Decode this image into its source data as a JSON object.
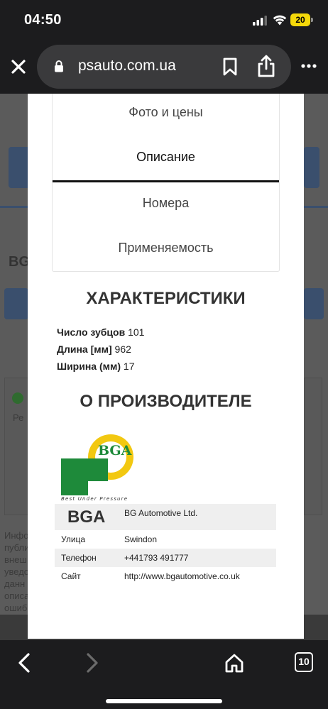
{
  "status": {
    "time": "04:50",
    "battery": "20",
    "icons": [
      "signal-icon",
      "wifi-icon",
      "battery-icon"
    ],
    "battery_color": "#f5d90a"
  },
  "browser": {
    "url": "psauto.com.ua",
    "icons": [
      "close-icon",
      "lock-icon",
      "bookmark-icon",
      "share-icon",
      "more-icon",
      "back-icon",
      "forward-icon",
      "home-icon"
    ],
    "tab_count": "10"
  },
  "background_page": {
    "title_fragment": "BG",
    "side_text_fragment": "Ре",
    "footer_lines": [
      "Инфо",
      "публи",
      "внеш",
      "уведо",
      "данн",
      "описа",
      "ошиб"
    ]
  },
  "modal": {
    "tabs": [
      {
        "label": "Фото и цены",
        "active": false
      },
      {
        "label": "Описание",
        "active": true
      },
      {
        "label": "Номера",
        "active": false
      },
      {
        "label": "Применяемость",
        "active": false
      }
    ],
    "specs_heading": "ХАРАКТЕРИСТИКИ",
    "specs": [
      {
        "name": "Число зубцов",
        "value": "101"
      },
      {
        "name": "Длина [мм]",
        "value": "962"
      },
      {
        "name": "Ширина (мм)",
        "value": "17"
      }
    ],
    "manufacturer_heading": "О ПРОИЗВОДИТЕЛЕ",
    "logo": {
      "text": "BGA",
      "tagline": "Best Under Pressure",
      "colors": {
        "green": "#1e8a3a",
        "yellow": "#f2c811"
      }
    },
    "manufacturer": {
      "brand": "BGA",
      "company": "BG Automotive Ltd.",
      "rows": [
        {
          "key": "Улица",
          "value": "Swindon"
        },
        {
          "key": "Телефон",
          "value": "+441793 491777"
        },
        {
          "key": "Сайт",
          "value": "http://www.bgautomotive.co.uk"
        }
      ]
    }
  }
}
